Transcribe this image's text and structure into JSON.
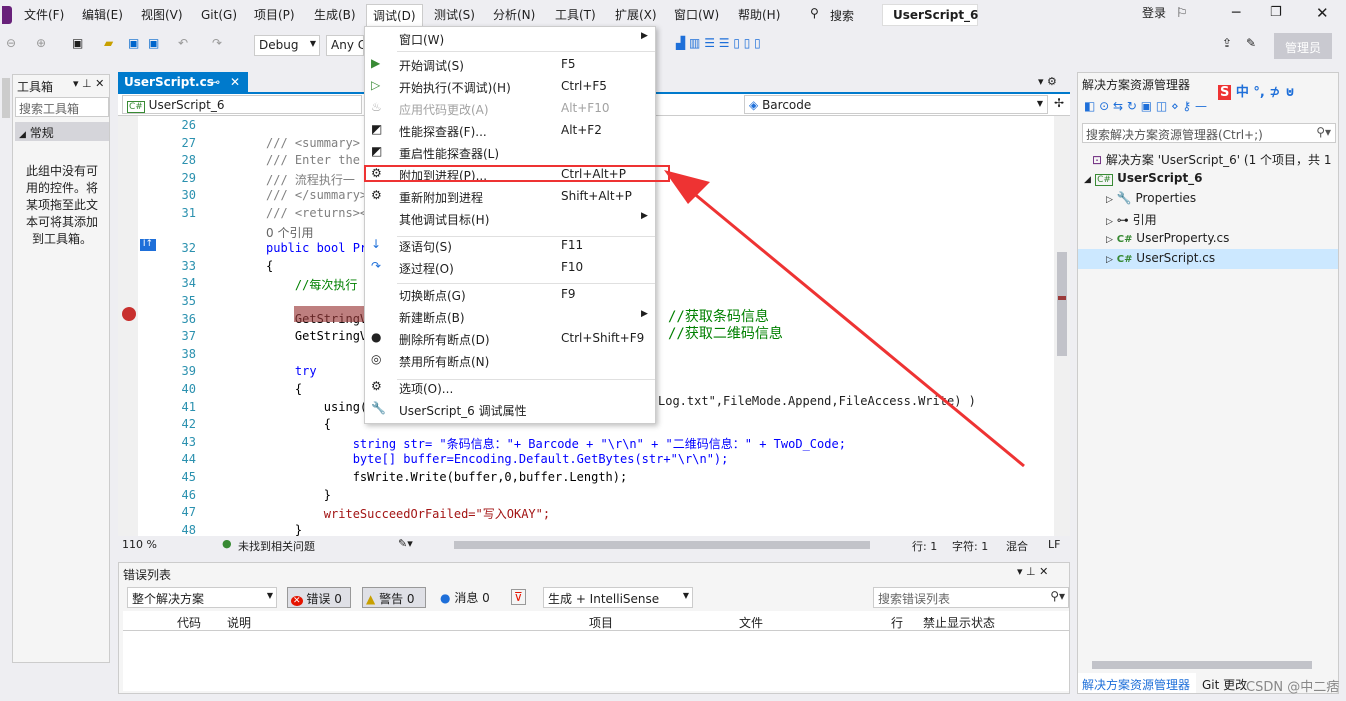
{
  "menu": {
    "items": [
      "文件(F)",
      "编辑(E)",
      "视图(V)",
      "Git(G)",
      "项目(P)",
      "生成(B)",
      "调试(D)",
      "测试(S)",
      "分析(N)",
      "工具(T)",
      "扩展(X)",
      "窗口(W)",
      "帮助(H)"
    ],
    "search": "搜索",
    "solution_name": "UserScript_6",
    "login": "登录",
    "admin": "管理员"
  },
  "toolbar": {
    "config": "Debug",
    "platform": "Any C"
  },
  "toolbox": {
    "title": "工具箱",
    "search_placeholder": "搜索工具箱",
    "group": "常规",
    "empty_text": "此组中没有可用的控件。将某项拖至此文本可将其添加到工具箱。"
  },
  "editor": {
    "tab": "UserScript.cs",
    "nav_left": "UserScript_6",
    "nav_right": "Barcode",
    "zoom": "110 %",
    "status_issues": "未找到相关问题",
    "line": "行: 1",
    "char": "字符: 1",
    "mixed": "混合",
    "eol": "LF",
    "lines": [
      {
        "n": "26",
        "text": ""
      },
      {
        "n": "27",
        "text": "/// <summary>"
      },
      {
        "n": "28",
        "text": "/// Enter the"
      },
      {
        "n": "29",
        "text": "/// 流程执行一"
      },
      {
        "n": "30",
        "text": "/// </summary>"
      },
      {
        "n": "31",
        "text": "/// <returns><"
      },
      {
        "n": "",
        "text": "0 个引用"
      },
      {
        "n": "32",
        "text": "public bool Pr"
      },
      {
        "n": "33",
        "text": "{"
      },
      {
        "n": "34",
        "text": "    //每次执行"
      },
      {
        "n": "35",
        "text": ""
      },
      {
        "n": "36",
        "text": "    GetStringV"
      },
      {
        "n": "37",
        "text": "    GetStringV"
      },
      {
        "n": "38",
        "text": ""
      },
      {
        "n": "39",
        "text": "    try"
      },
      {
        "n": "40",
        "text": "    {"
      },
      {
        "n": "41",
        "text": "        using(F"
      },
      {
        "n": "42",
        "text": "        {"
      },
      {
        "n": "43",
        "text": "            string str= \"条码信息：\"+ Barcode + \"\\r\\n\" + \"二维码信息：\" + TwoD_Code;"
      },
      {
        "n": "44",
        "text": "            byte[] buffer=Encoding.Default.GetBytes(str+\"\\r\\n\");"
      },
      {
        "n": "45",
        "text": "            fsWrite.Write(buffer,0,buffer.Length);"
      },
      {
        "n": "46",
        "text": "        }"
      },
      {
        "n": "47",
        "text": "        writeSucceedOrFailed=\"写入OKAY\";"
      },
      {
        "n": "48",
        "text": "    }"
      }
    ],
    "comment36": "//获取条码信息",
    "comment37": "//获取二维码信息",
    "line41_tail": "Log.txt\",FileMode.Append,FileAccess.Write) )"
  },
  "debug_menu": {
    "items": [
      {
        "label": "窗口(W)",
        "shortcut": "",
        "icon": "",
        "submenu": true,
        "disabled": false
      },
      {
        "label": "开始调试(S)",
        "shortcut": "F5",
        "icon": "play-icon",
        "submenu": false,
        "disabled": false
      },
      {
        "label": "开始执行(不调试)(H)",
        "shortcut": "Ctrl+F5",
        "icon": "play-outline-icon",
        "submenu": false,
        "disabled": false
      },
      {
        "label": "应用代码更改(A)",
        "shortcut": "Alt+F10",
        "icon": "flame-icon",
        "submenu": false,
        "disabled": true
      },
      {
        "label": "性能探查器(F)...",
        "shortcut": "Alt+F2",
        "icon": "profiler-icon",
        "submenu": false,
        "disabled": false
      },
      {
        "label": "重启性能探查器(L)",
        "shortcut": "",
        "icon": "profiler-icon",
        "submenu": false,
        "disabled": false
      },
      {
        "label": "附加到进程(P)...",
        "shortcut": "Ctrl+Alt+P",
        "icon": "gear-attach-icon",
        "submenu": false,
        "disabled": false
      },
      {
        "label": "重新附加到进程",
        "shortcut": "Shift+Alt+P",
        "icon": "gear-attach-icon",
        "submenu": false,
        "disabled": false
      },
      {
        "label": "其他调试目标(H)",
        "shortcut": "",
        "icon": "",
        "submenu": true,
        "disabled": false
      },
      {
        "label": "逐语句(S)",
        "shortcut": "F11",
        "icon": "step-into-icon",
        "submenu": false,
        "disabled": false
      },
      {
        "label": "逐过程(O)",
        "shortcut": "F10",
        "icon": "step-over-icon",
        "submenu": false,
        "disabled": false
      },
      {
        "label": "切换断点(G)",
        "shortcut": "F9",
        "icon": "",
        "submenu": false,
        "disabled": false
      },
      {
        "label": "新建断点(B)",
        "shortcut": "",
        "icon": "",
        "submenu": true,
        "disabled": false
      },
      {
        "label": "删除所有断点(D)",
        "shortcut": "Ctrl+Shift+F9",
        "icon": "delete-breakpoints-icon",
        "submenu": false,
        "disabled": false
      },
      {
        "label": "禁用所有断点(N)",
        "shortcut": "",
        "icon": "disable-breakpoints-icon",
        "submenu": false,
        "disabled": false
      },
      {
        "label": "选项(O)...",
        "shortcut": "",
        "icon": "gear-icon",
        "submenu": false,
        "disabled": false
      },
      {
        "label": "UserScript_6 调试属性",
        "shortcut": "",
        "icon": "wrench-icon",
        "submenu": false,
        "disabled": false
      }
    ]
  },
  "solution_explorer": {
    "title": "解决方案资源管理器",
    "search_placeholder": "搜索解决方案资源管理器(Ctrl+;)",
    "solution": "解决方案 'UserScript_6' (1 个项目，共 1",
    "project": "UserScript_6",
    "children": [
      "Properties",
      "引用",
      "UserProperty.cs",
      "UserScript.cs"
    ],
    "bottom_tab1": "解决方案资源管理器",
    "bottom_tab2": "Git 更改"
  },
  "error_list": {
    "title": "错误列表",
    "scope": "整个解决方案",
    "errors": "错误 0",
    "warnings": "警告 0",
    "messages": "消息 0",
    "build": "生成 + IntelliSense",
    "search_placeholder": "搜索错误列表",
    "columns": [
      "代码",
      "说明",
      "项目",
      "文件",
      "行",
      "禁止显示状态"
    ]
  },
  "watermark": "CSDN @中二痞",
  "colors": {
    "accent": "#007acc",
    "highlight": "#e33",
    "selection": "#cce8ff"
  }
}
